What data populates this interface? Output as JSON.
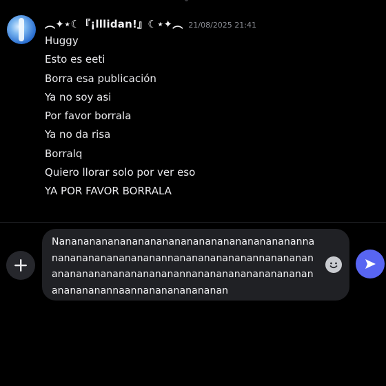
{
  "message": {
    "username": "︵✦⋆☾『¡lllidan!』☾⋆✦︵",
    "timestamp": "21/08/2025 21:41",
    "lines": [
      "Huggy",
      "Esto es eeti",
      "Borra esa publicación",
      "Ya no soy asi",
      "Por favor borrala",
      "Ya no da risa",
      "Borralq",
      "Quiero llorar solo por ver eso",
      "YA POR FAVOR BORRALA"
    ]
  },
  "composer": {
    "value": "Nanananananananananananananananananananannanananananananananannananananananannananananananananananananananannananananananananananananananannaannananananananan",
    "icons": {
      "add": "plus-icon",
      "emoji": "emoji-icon",
      "send": "send-icon"
    }
  },
  "colors": {
    "background": "#000000",
    "composer_bg": "#202125",
    "send_accent": "#5865f2"
  }
}
